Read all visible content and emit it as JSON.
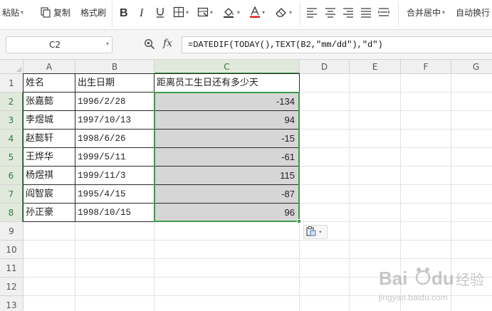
{
  "toolbar": {
    "paste_label": "粘贴",
    "copy_label": "复制",
    "format_painter_label": "格式刷",
    "merge_center_label": "合并居中",
    "auto_wrap_label": "自动换行",
    "font_color": "#e02020",
    "icons": [
      "paste-icon",
      "copy-icon",
      "format-painter-icon",
      "bold-icon",
      "italic-icon",
      "underline-icon",
      "border-icon",
      "cell-fill-style-icon",
      "fill-color-icon",
      "font-color-icon",
      "clear-format-icon",
      "align-left-icon",
      "align-center-icon",
      "align-right-icon",
      "justify-icon",
      "distributed-icon"
    ]
  },
  "formula_bar": {
    "name_box": "C2",
    "fx_label": "fx",
    "formula": "=DATEDIF(TODAY(),TEXT(B2,\"mm/dd\"),\"d\")"
  },
  "columns": [
    "A",
    "B",
    "C",
    "D",
    "E",
    "F",
    "G"
  ],
  "selected_column": "C",
  "rows": [
    "1",
    "2",
    "3",
    "4",
    "5",
    "6",
    "7",
    "8",
    "9",
    "10",
    "11",
    "12",
    "13"
  ],
  "table": {
    "headers": [
      "姓名",
      "出生日期",
      "距离员工生日还有多少天"
    ],
    "records": [
      {
        "name": "张嘉懿",
        "birth": "1996/2/28",
        "days": "-134"
      },
      {
        "name": "李煜城",
        "birth": "1997/10/13",
        "days": "94"
      },
      {
        "name": "赵懿轩",
        "birth": "1998/6/26",
        "days": "-15"
      },
      {
        "name": "王烨华",
        "birth": "1999/5/11",
        "days": "-61"
      },
      {
        "name": "杨煜祺",
        "birth": "1999/11/3",
        "days": "115"
      },
      {
        "name": "阎智宸",
        "birth": "1995/4/15",
        "days": "-87"
      },
      {
        "name": "孙正豪",
        "birth": "1998/10/15",
        "days": "96"
      }
    ]
  },
  "selection_color": "#3d9a4b",
  "watermark": {
    "brand": "Baidu 经验",
    "sub": "jingyan.baidu.com"
  }
}
